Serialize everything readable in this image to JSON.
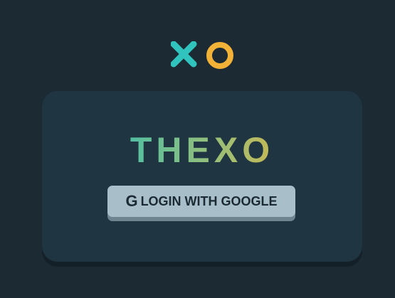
{
  "logo": {
    "x_icon": "x-mark-icon",
    "o_icon": "o-ring-icon"
  },
  "title": "THEXO",
  "login": {
    "icon": "google-g-icon",
    "icon_glyph": "G",
    "label": "LOGIN WITH GOOGLE"
  },
  "colors": {
    "background": "#1b2a33",
    "card": "#1f3541",
    "x_color": "#31c3bd",
    "o_color": "#f2b137",
    "button": "#a8bfc9",
    "button_shadow": "#6e848f"
  }
}
